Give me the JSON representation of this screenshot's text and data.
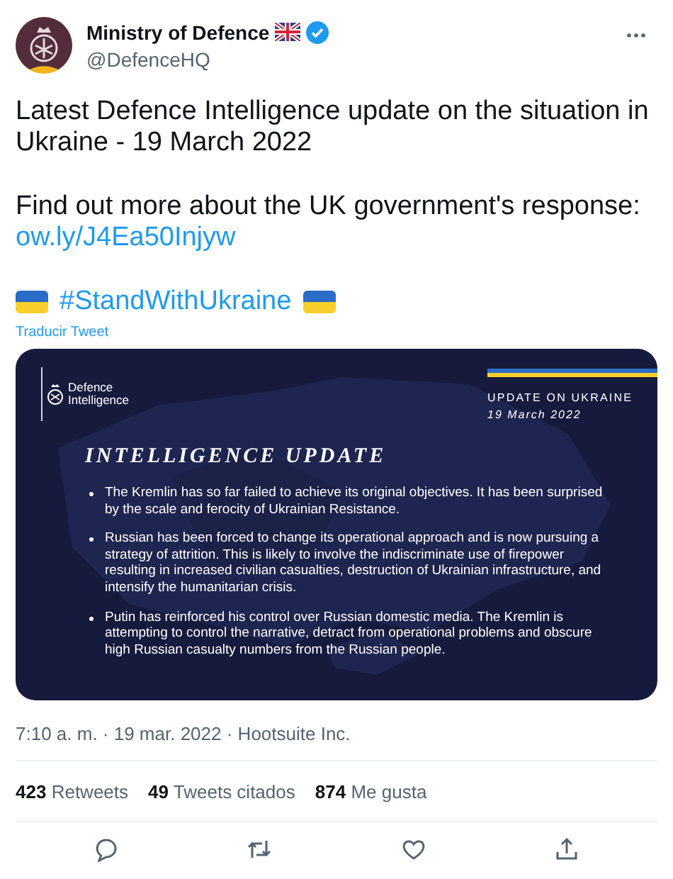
{
  "author": {
    "name": "Ministry of Defence",
    "handle": "@DefenceHQ",
    "verified": true
  },
  "tweet": {
    "text": "Latest Defence Intelligence update on the situation in Ukraine - 19 March 2022",
    "cta": "Find out more about the UK government's response:",
    "link": "ow.ly/J4Ea50Injyw",
    "hashtag": "#StandWithUkraine",
    "translate": "Traducir Tweet"
  },
  "card": {
    "brand": [
      "Defence",
      "Intelligence"
    ],
    "label": "UPDATE ON UKRAINE",
    "date": "19 March 2022",
    "heading": "INTELLIGENCE UPDATE",
    "bullets": [
      "The Kremlin has so far failed to achieve its original objectives. It has been surprised by the scale and ferocity of Ukrainian Resistance.",
      "Russian has been forced to change its operational approach and is now pursuing a strategy of attrition. This is likely to involve the indiscriminate use of firepower resulting in increased civilian casualties, destruction of Ukrainian infrastructure, and intensify the humanitarian crisis.",
      "Putin has reinforced his control over Russian domestic media. The Kremlin is attempting to control the narrative, detract from operational problems and obscure high Russian casualty numbers from the Russian people."
    ]
  },
  "meta": "7:10 a. m. · 19 mar. 2022 · Hootsuite Inc.",
  "stats": [
    {
      "count": "423",
      "label": "Retweets"
    },
    {
      "count": "49",
      "label": "Tweets citados"
    },
    {
      "count": "874",
      "label": "Me gusta"
    }
  ],
  "actions": [
    {
      "kind": "reply"
    },
    {
      "kind": "retweet"
    },
    {
      "kind": "like"
    },
    {
      "kind": "share"
    }
  ]
}
